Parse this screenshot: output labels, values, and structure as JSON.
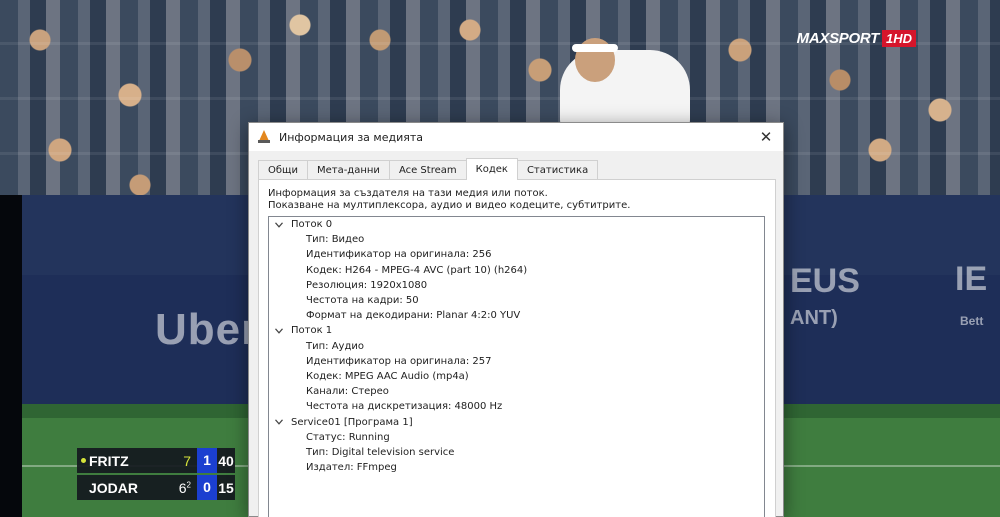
{
  "channel": {
    "name": "MAXSPORT",
    "hd_badge": "1HD"
  },
  "ads": {
    "left": "Uber",
    "right_top": "EUS",
    "right_bottom": "ANT)",
    "far_right": "IE",
    "far_right_small": "Bett"
  },
  "scoreboard": {
    "players": [
      {
        "name": "FRITZ",
        "set1": "7",
        "tiebreak": "",
        "current_set": "1",
        "points": "40",
        "serving": true
      },
      {
        "name": "JODAR",
        "set1": "6",
        "tiebreak": "2",
        "current_set": "0",
        "points": "15",
        "serving": false
      }
    ],
    "colors": {
      "serve_dot": "#d6e43a",
      "current_set_bg": "#1b3fd0"
    }
  },
  "dialog": {
    "title": "Информация за медията",
    "close_glyph": "✕",
    "tabs": [
      {
        "label": "Общи",
        "active": false
      },
      {
        "label": "Мета-данни",
        "active": false
      },
      {
        "label": "Ace Stream",
        "active": false
      },
      {
        "label": "Кодек",
        "active": true
      },
      {
        "label": "Статистика",
        "active": false
      }
    ],
    "description_line1": "Информация за създателя на тази медия или поток.",
    "description_line2": "Показване на мултиплексора, аудио и видео кодеците, субтитрите.",
    "tree": [
      {
        "label": "Поток 0",
        "children": [
          "Тип: Видео",
          "Идентификатор на оригинала: 256",
          "Кодек: H264 - MPEG-4 AVC (part 10) (h264)",
          "Резолюция: 1920x1080",
          "Честота на кадри: 50",
          "Формат на декодирани: Planar 4:2:0 YUV"
        ]
      },
      {
        "label": "Поток 1",
        "children": [
          "Тип: Аудио",
          "Идентификатор на оригинала: 257",
          "Кодек: MPEG AAC Audio (mp4a)",
          "Канали: Стерео",
          "Честота на дискретизация: 48000 Hz"
        ]
      },
      {
        "label": "Service01 [Програма 1]",
        "children": [
          "Статус: Running",
          "Тип: Digital television service",
          "Издател: FFmpeg"
        ]
      }
    ]
  }
}
